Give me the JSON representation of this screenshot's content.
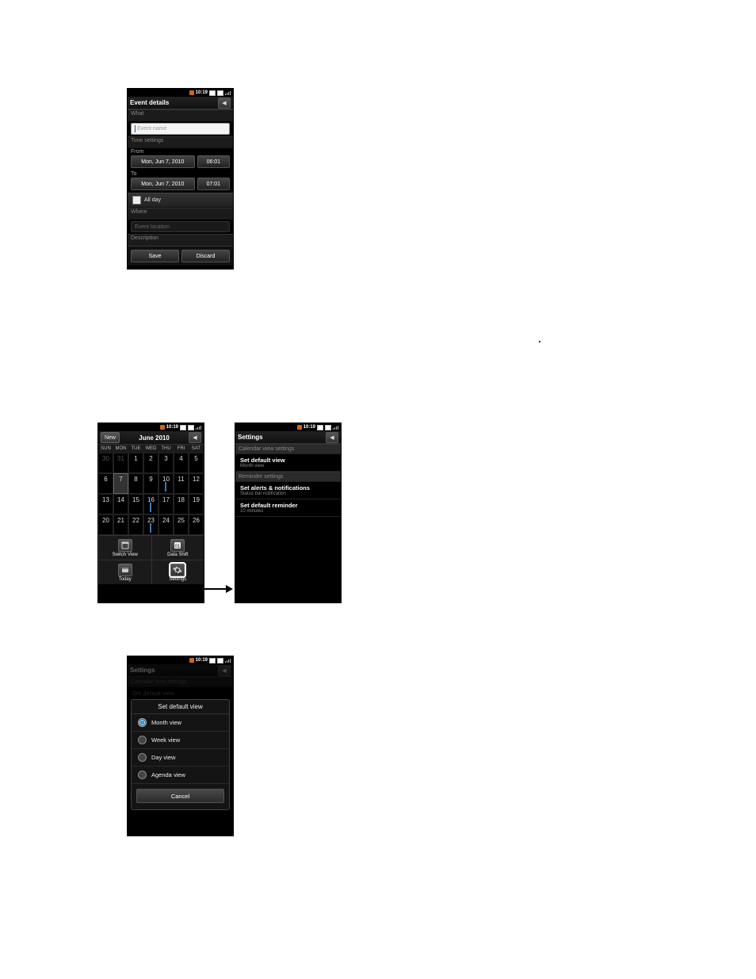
{
  "status": {
    "time": "10:19"
  },
  "event": {
    "title": "Event details",
    "what_label": "What",
    "name_placeholder": "Event name",
    "time_label": "Time settings",
    "from_label": "From",
    "from_date": "Mon, Jun 7, 2010",
    "from_time": "06:01",
    "to_label": "To",
    "to_date": "Mon, Jun 7, 2010",
    "to_time": "07:01",
    "allday_label": "All day",
    "where_label": "Where",
    "location_placeholder": "Event location",
    "description_label": "Description",
    "save": "Save",
    "discard": "Discard"
  },
  "calendar": {
    "new_btn": "New",
    "month_title": "June 2010",
    "dow": [
      "SUN",
      "MON",
      "TUE",
      "WED",
      "THU",
      "FRI",
      "SAT"
    ],
    "cells": [
      {
        "d": "30",
        "dim": true
      },
      {
        "d": "31",
        "dim": true
      },
      {
        "d": "1"
      },
      {
        "d": "2"
      },
      {
        "d": "3"
      },
      {
        "d": "4"
      },
      {
        "d": "5"
      },
      {
        "d": "6"
      },
      {
        "d": "7",
        "sel": true
      },
      {
        "d": "8"
      },
      {
        "d": "9"
      },
      {
        "d": "10",
        "bar": true
      },
      {
        "d": "11"
      },
      {
        "d": "12"
      },
      {
        "d": "13"
      },
      {
        "d": "14"
      },
      {
        "d": "15"
      },
      {
        "d": "16",
        "bar": true
      },
      {
        "d": "17"
      },
      {
        "d": "18"
      },
      {
        "d": "19"
      },
      {
        "d": "20"
      },
      {
        "d": "21"
      },
      {
        "d": "22"
      },
      {
        "d": "23",
        "bar": true
      },
      {
        "d": "24"
      },
      {
        "d": "25"
      },
      {
        "d": "26"
      }
    ],
    "menu": {
      "switch_view": "Switch View",
      "data_shift": "Data Shift",
      "today": "Today",
      "settings": "Settings"
    }
  },
  "settings": {
    "title": "Settings",
    "sect_cal": "Calendar view settings",
    "default_view": "Set default view",
    "default_view_sub": "Month view",
    "sect_rem": "Reminder settings",
    "alerts": "Set alerts & notifications",
    "alerts_sub": "Status bar notification",
    "default_rem": "Set default reminder",
    "default_rem_sub": "10 minutes"
  },
  "dialog": {
    "title": "Set default view",
    "options": [
      "Month view",
      "Week view",
      "Day view",
      "Agenda view"
    ],
    "selected": 0,
    "cancel": "Cancel"
  }
}
